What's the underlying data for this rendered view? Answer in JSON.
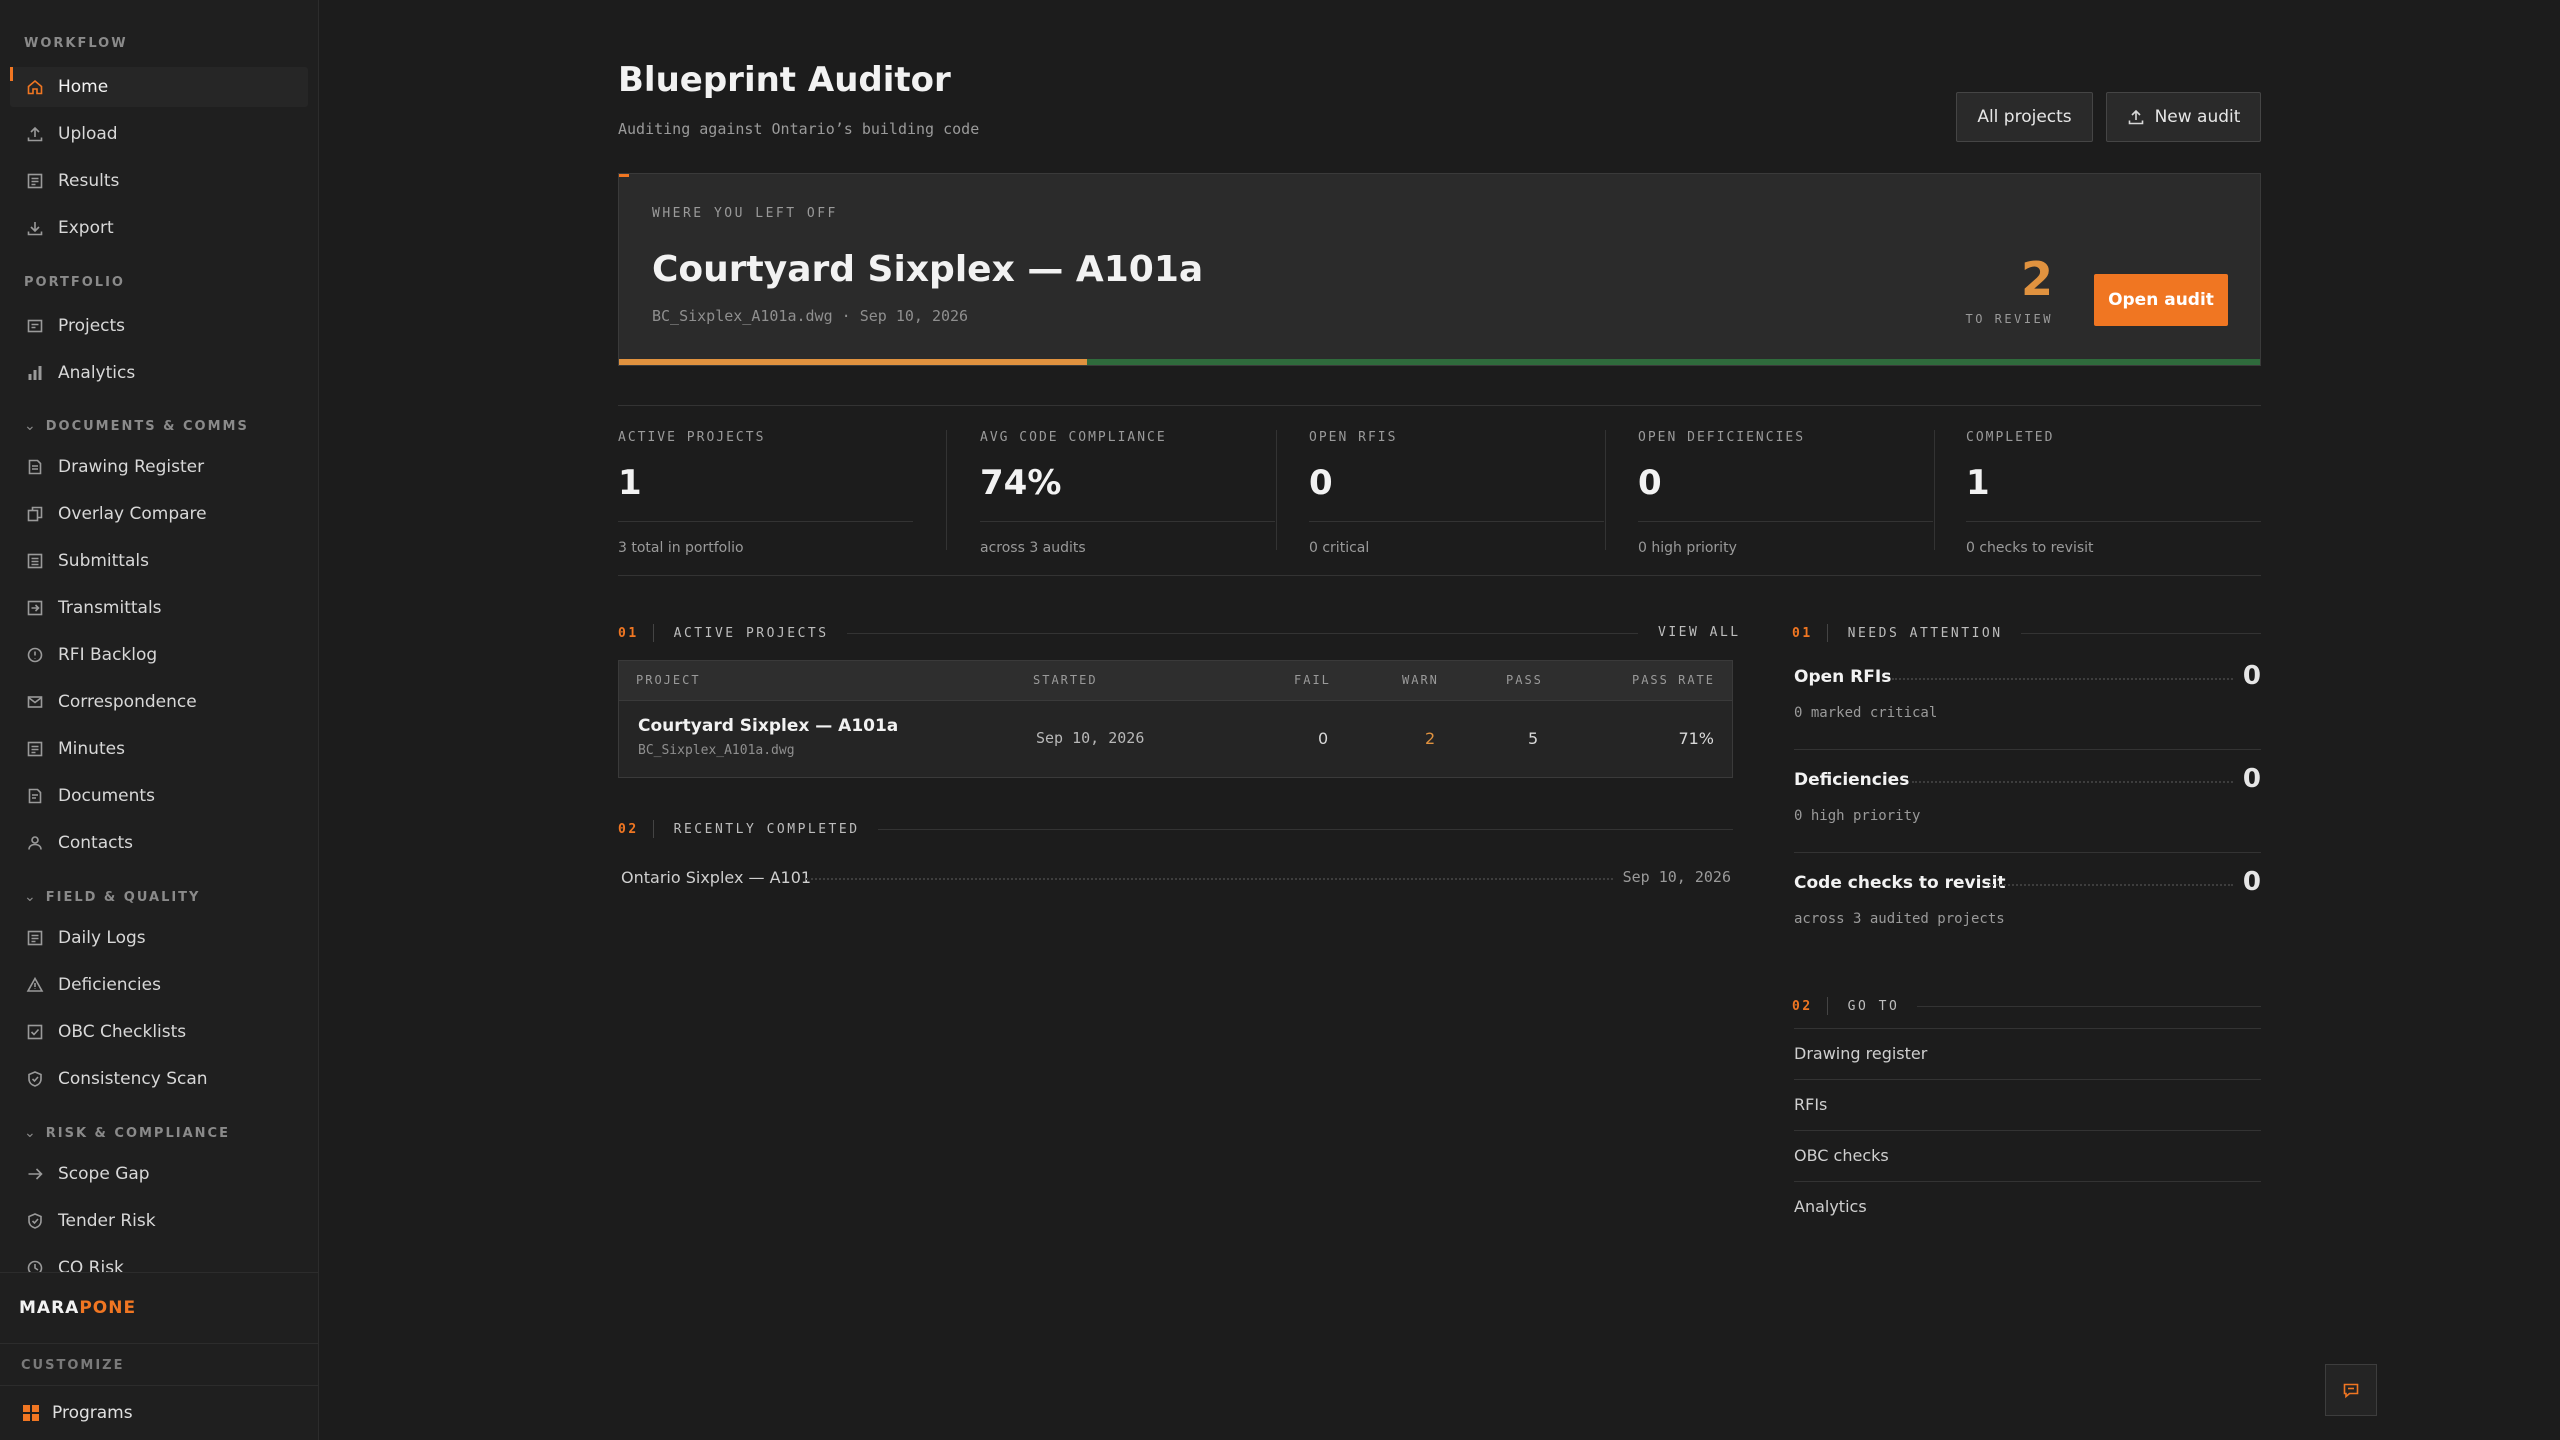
{
  "sidebar": {
    "sections": {
      "workflow": "WORKFLOW",
      "portfolio": "PORTFOLIO",
      "documents": "DOCUMENTS & COMMS",
      "field": "FIELD & QUALITY",
      "risk": "RISK & COMPLIANCE"
    },
    "workflow_items": [
      "Home",
      "Upload",
      "Results",
      "Export"
    ],
    "portfolio_items": [
      "Projects",
      "Analytics"
    ],
    "documents_items": [
      "Drawing Register",
      "Overlay Compare",
      "Submittals",
      "Transmittals",
      "RFI Backlog",
      "Correspondence",
      "Minutes",
      "Documents",
      "Contacts"
    ],
    "field_items": [
      "Daily Logs",
      "Deficiencies",
      "OBC Checklists",
      "Consistency Scan"
    ],
    "risk_items": [
      "Scope Gap",
      "Tender Risk",
      "CO Risk"
    ],
    "brand_a": "MARA",
    "brand_b": "PONE",
    "customize": "CUSTOMIZE",
    "programs": "Programs"
  },
  "header": {
    "title": "Blueprint Auditor",
    "subtitle": "Auditing against Ontario’s building code",
    "all_projects": "All projects",
    "new_audit": "New audit"
  },
  "hero": {
    "kicker": "WHERE YOU LEFT OFF",
    "title": "Courtyard Sixplex — A101a",
    "meta": "BC_Sixplex_A101a.dwg · Sep 10, 2026",
    "count": "2",
    "count_label": "TO REVIEW",
    "open_audit": "Open audit",
    "progress": 0.285
  },
  "kpis": [
    {
      "label": "ACTIVE PROJECTS",
      "value": "1",
      "sub": "3 total in portfolio"
    },
    {
      "label": "AVG CODE COMPLIANCE",
      "value": "74%",
      "sub": "across 3 audits"
    },
    {
      "label": "OPEN RFIS",
      "value": "0",
      "sub": "0 critical"
    },
    {
      "label": "OPEN DEFICIENCIES",
      "value": "0",
      "sub": "0 high priority"
    },
    {
      "label": "COMPLETED",
      "value": "1",
      "sub": "0 checks to revisit"
    }
  ],
  "active_projects": {
    "num": "01",
    "title": "ACTIVE PROJECTS",
    "view_all": "VIEW ALL",
    "columns": [
      "PROJECT",
      "STARTED",
      "FAIL",
      "WARN",
      "PASS",
      "PASS RATE"
    ],
    "row": {
      "name": "Courtyard Sixplex — A101a",
      "file": "BC_Sixplex_A101a.dwg",
      "started": "Sep 10, 2026",
      "fail": "0",
      "warn": "2",
      "pass": "5",
      "pass_rate": "71%"
    }
  },
  "recently_completed": {
    "num": "02",
    "title": "RECENTLY COMPLETED",
    "item": {
      "name": "Ontario Sixplex — A101",
      "date": "Sep 10, 2026"
    }
  },
  "needs_attention": {
    "num": "01",
    "title": "NEEDS ATTENTION",
    "items": [
      {
        "title": "Open RFIs",
        "sub": "0 marked critical",
        "value": "0"
      },
      {
        "title": "Deficiencies",
        "sub": "0 high priority",
        "value": "0"
      },
      {
        "title": "Code checks to revisit",
        "sub": "across 3 audited projects",
        "value": "0"
      }
    ]
  },
  "go_to": {
    "num": "02",
    "title": "GO TO",
    "links": [
      "Drawing register",
      "RFIs",
      "OBC checks",
      "Analytics"
    ]
  },
  "colors": {
    "accent": "#f07622",
    "warn": "#e0923f",
    "pass_track": "#2f6b3c"
  }
}
